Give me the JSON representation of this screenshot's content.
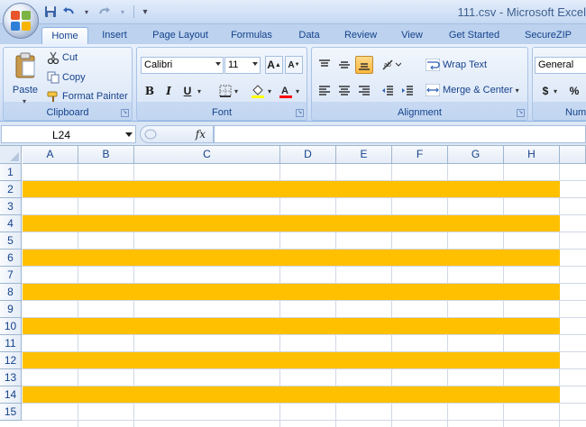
{
  "window": {
    "title": "111.csv - Microsoft Excel"
  },
  "quick_access": {
    "save_icon": "save-icon",
    "undo_icon": "undo-icon",
    "redo_icon": "redo-icon"
  },
  "tabs": [
    {
      "label": "Home",
      "active": true
    },
    {
      "label": "Insert"
    },
    {
      "label": "Page Layout"
    },
    {
      "label": "Formulas"
    },
    {
      "label": "Data"
    },
    {
      "label": "Review"
    },
    {
      "label": "View"
    },
    {
      "label": "Get Started"
    },
    {
      "label": "SecureZIP"
    }
  ],
  "clipboard": {
    "label": "Clipboard",
    "paste": "Paste",
    "cut": "Cut",
    "copy": "Copy",
    "format_painter": "Format Painter"
  },
  "font": {
    "label": "Font",
    "family": "Calibri",
    "size": "11",
    "bold": "B",
    "italic": "I",
    "underline": "U",
    "font_color": "#ff0000",
    "highlight_color": "#ffff00"
  },
  "alignment": {
    "label": "Alignment",
    "wrap_text": "Wrap Text",
    "merge_center": "Merge & Center"
  },
  "number": {
    "label": "Num",
    "format": "General",
    "currency": "$",
    "percent": "%"
  },
  "formula_bar": {
    "name_box": "L24",
    "fx": "fx",
    "content": ""
  },
  "sheet": {
    "columns": [
      "A",
      "B",
      "C",
      "D",
      "E",
      "F",
      "G",
      "H"
    ],
    "rows": [
      "1",
      "2",
      "3",
      "4",
      "5",
      "6",
      "7",
      "8",
      "9",
      "10",
      "11",
      "12",
      "13",
      "14",
      "15"
    ],
    "highlight_color": "#ffc000",
    "highlighted_rows": [
      "2",
      "4",
      "6",
      "8",
      "10",
      "12",
      "14"
    ]
  }
}
